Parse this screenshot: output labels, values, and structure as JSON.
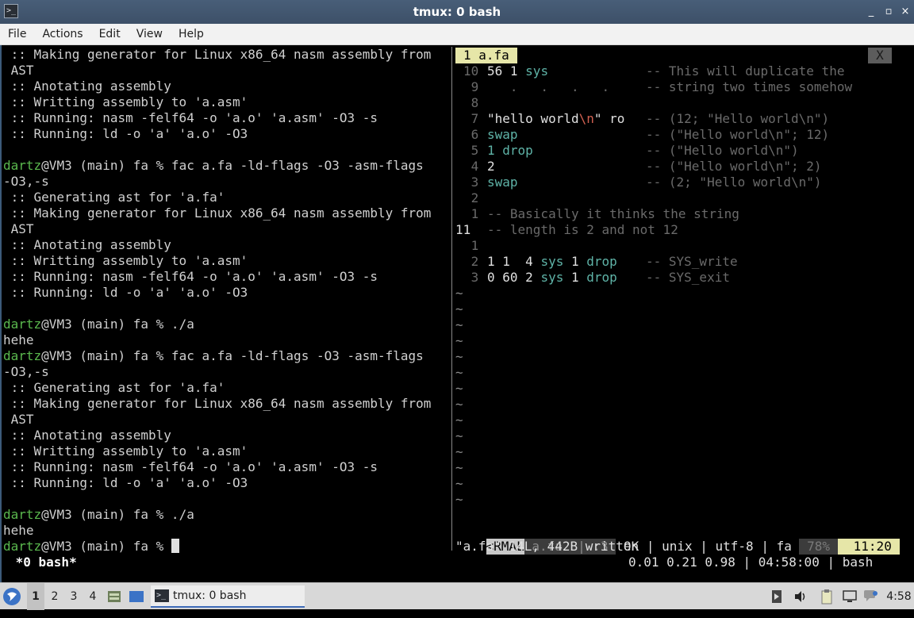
{
  "window": {
    "title": "tmux: 0 bash",
    "app_icon": "terminal-icon",
    "controls": [
      "_",
      "▫",
      "×"
    ]
  },
  "menu": [
    "File",
    "Actions",
    "Edit",
    "View",
    "Help"
  ],
  "left_pane": [
    {
      "t": ":: Making generator for Linux x86_64 nasm assembly from"
    },
    {
      "t": " AST"
    },
    {
      "t": ":: Anotating assembly"
    },
    {
      "t": ":: Writting assembly to 'a.asm'"
    },
    {
      "t": ":: Running: nasm -felf64 -o 'a.o' 'a.asm' -O3 -s"
    },
    {
      "t": ":: Running: ld -o 'a' 'a.o' -O3"
    },
    {
      "t": ""
    },
    {
      "p": "dartz",
      "t": "@VM3 (main) fa % fac a.fa -ld-flags -O3 -asm-flags"
    },
    {
      "t": "-O3,-s"
    },
    {
      "t": ":: Generating ast for 'a.fa'"
    },
    {
      "t": ":: Making generator for Linux x86_64 nasm assembly from"
    },
    {
      "t": " AST"
    },
    {
      "t": ":: Anotating assembly"
    },
    {
      "t": ":: Writting assembly to 'a.asm'"
    },
    {
      "t": ":: Running: nasm -felf64 -o 'a.o' 'a.asm' -O3 -s"
    },
    {
      "t": ":: Running: ld -o 'a' 'a.o' -O3"
    },
    {
      "t": ""
    },
    {
      "p": "dartz",
      "t": "@VM3 (main) fa % ./a"
    },
    {
      "t": "hehe"
    },
    {
      "p": "dartz",
      "t": "@VM3 (main) fa % fac a.fa -ld-flags -O3 -asm-flags"
    },
    {
      "t": "-O3,-s"
    },
    {
      "t": ":: Generating ast for 'a.fa'"
    },
    {
      "t": ":: Making generator for Linux x86_64 nasm assembly from"
    },
    {
      "t": " AST"
    },
    {
      "t": ":: Anotating assembly"
    },
    {
      "t": ":: Writting assembly to 'a.asm'"
    },
    {
      "t": ":: Running: nasm -felf64 -o 'a.o' 'a.asm' -O3 -s"
    },
    {
      "t": ":: Running: ld -o 'a' 'a.o' -O3"
    },
    {
      "t": ""
    },
    {
      "p": "dartz",
      "t": "@VM3 (main) fa % ./a"
    },
    {
      "t": "hehe"
    },
    {
      "p": "dartz",
      "t": "@VM3 (main) fa % ",
      "cursor": true
    }
  ],
  "vim": {
    "tab": "1 a.fa",
    "close": "X",
    "lines": [
      {
        "n": "10",
        "code": "56 1 sys",
        "cls": "",
        "comment": "-- This will duplicate the"
      },
      {
        "n": " 9",
        "code": "   .   .   .   .",
        "cls": "dim",
        "comment": "-- string two times somehow"
      },
      {
        "n": " 8",
        "code": "",
        "cls": "",
        "comment": ""
      },
      {
        "n": " 7",
        "code": "\"hello world\\n\" ro",
        "cls": "str",
        "comment": "-- (12; \"Hello world\\n\")"
      },
      {
        "n": " 6",
        "code": "swap",
        "cls": "kw",
        "comment": "-- (\"Hello world\\n\"; 12)"
      },
      {
        "n": " 5",
        "code": "1 drop",
        "cls": "kw2",
        "comment": "-- (\"Hello world\\n\")"
      },
      {
        "n": " 4",
        "code": "2",
        "cls": "",
        "comment": "-- (\"Hello world\\n\"; 2)"
      },
      {
        "n": " 3",
        "code": "swap",
        "cls": "kw",
        "comment": "-- (2; \"Hello world\\n\")"
      },
      {
        "n": " 2",
        "code": "",
        "cls": "",
        "comment": ""
      },
      {
        "n": " 1",
        "code": "",
        "cls": "",
        "comment": "-- Basically it thinks the string"
      },
      {
        "n": "11",
        "code": "",
        "cls": "",
        "comment": "-- length is 2 and not 12",
        "cur": true
      },
      {
        "n": " 1",
        "code": "",
        "cls": "",
        "comment": ""
      },
      {
        "n": " 2",
        "code": "1 1  4 sys 1 drop",
        "cls": "sys",
        "comment": "-- SYS_write"
      },
      {
        "n": " 3",
        "code": "0 60 2 sys 1 drop",
        "cls": "sys",
        "comment": "-- SYS_exit"
      }
    ],
    "tilde_count": 14,
    "status": {
      "mode": "<RMAL",
      "file": " a.fa  | :3 ",
      "info": " OK | unix | utf-8 | fa ",
      "percent": " 78% ",
      "pos": "11:20"
    },
    "message": "\"a.fa\" 14L, 442B written"
  },
  "tmux": {
    "window_label": " *0 bash*",
    "right": "0.01 0.21 0.98 | 04:58:00 | bash"
  },
  "taskbar": {
    "workspaces": [
      "1",
      "2",
      "3",
      "4"
    ],
    "active_workspace": 0,
    "task_label": "tmux: 0 bash",
    "clock": "4:58"
  },
  "colors": {
    "prompt_user": "#5ab84e",
    "vim_tab_bg": "#e6e6a8",
    "window_title_bg": "#3d5068"
  }
}
